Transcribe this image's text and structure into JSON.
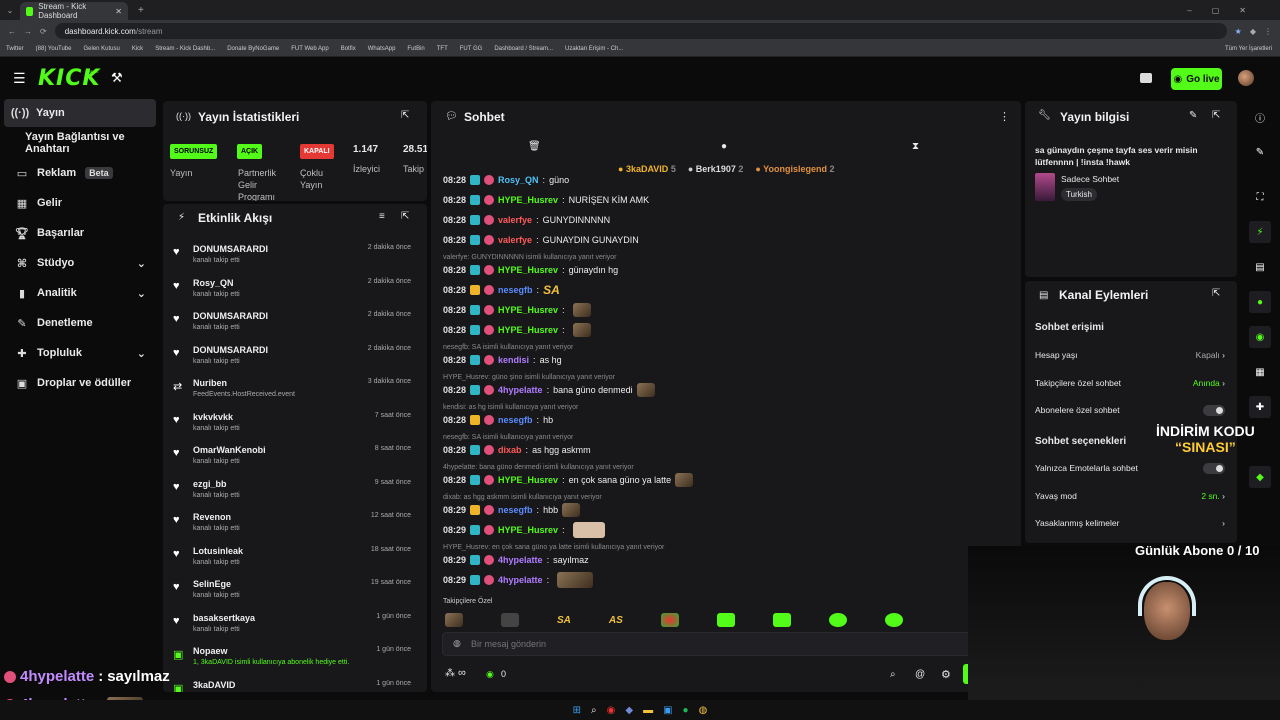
{
  "browser": {
    "tab_title": "Stream - Kick Dashboard",
    "url_host": "dashboard.kick.com",
    "url_path": "/stream",
    "bookmarks": [
      "Twitter",
      "(88) YouTube",
      "Gelen Kutusu",
      "Kick",
      "Stream - Kick Dashb...",
      "Donate ByNoGame",
      "FUT Web App",
      "Botfix",
      "WhatsApp",
      "FutBin",
      "TFT",
      "FUT GG",
      "Dashboard / Stream...",
      "Uzaktan Erişim - Ch..."
    ],
    "all_bookmarks": "Tüm Yer İşaretleri"
  },
  "header": {
    "logo": "KICK",
    "logo_sup": "BETA",
    "go_live": "Go live"
  },
  "sidebar": {
    "items": [
      {
        "label": "Yayın"
      },
      {
        "label": "Yayın Bağlantısı ve Anahtarı"
      },
      {
        "label": "Reklam",
        "badge": "Beta"
      },
      {
        "label": "Gelir"
      },
      {
        "label": "Başarılar"
      },
      {
        "label": "Stüdyo"
      },
      {
        "label": "Analitik"
      },
      {
        "label": "Denetleme"
      },
      {
        "label": "Topluluk"
      },
      {
        "label": "Droplar ve ödüller"
      }
    ]
  },
  "stats": {
    "title": "Yayın İstatistikleri",
    "tags": [
      "SORUNSUZ",
      "AÇIK",
      "KAPALI"
    ],
    "viewers": "1.147",
    "followers": "28.51",
    "labels": [
      "Yayın",
      "Partnerlik Gelir Programı",
      "Çoklu Yayın",
      "İzleyici",
      "Takip"
    ]
  },
  "feed": {
    "title": "Etkinlik Akışı",
    "items": [
      {
        "name": "DONUMSARARDI",
        "sub": "kanalı takip etti",
        "time": "2 dakika önce"
      },
      {
        "name": "Rosy_QN",
        "sub": "kanalı takip etti",
        "time": "2 dakika önce"
      },
      {
        "name": "DONUMSARARDI",
        "sub": "kanalı takip etti",
        "time": "2 dakika önce"
      },
      {
        "name": "DONUMSARARDI",
        "sub": "kanalı takip etti",
        "time": "2 dakika önce"
      },
      {
        "name": "Nuriben",
        "sub": "FeedEvents.HostReceived.event",
        "time": "3 dakika önce"
      },
      {
        "name": "kvkvkvkk",
        "sub": "kanalı takip etti",
        "time": "7 saat önce"
      },
      {
        "name": "OmarWanKenobi",
        "sub": "kanalı takip etti",
        "time": "8 saat önce"
      },
      {
        "name": "ezgi_bb",
        "sub": "kanalı takip etti",
        "time": "9 saat önce"
      },
      {
        "name": "Revenon",
        "sub": "kanalı takip etti",
        "time": "12 saat önce"
      },
      {
        "name": "Lotusinleak",
        "sub": "kanalı takip etti",
        "time": "18 saat önce"
      },
      {
        "name": "SelinEge",
        "sub": "kanalı takip etti",
        "time": "19 saat önce"
      },
      {
        "name": "basaksertkaya",
        "sub": "kanalı takip etti",
        "time": "1 gün önce"
      },
      {
        "name": "Nopaew",
        "sub": "1, 3kaDAVID isimli kullanıcıya abonelik hediye etti.",
        "time": "1 gün önce"
      },
      {
        "name": "3kaDAVID",
        "sub": "",
        "time": "1 gün önce"
      }
    ]
  },
  "chat": {
    "title": "Sohbet",
    "leaders": [
      {
        "name": "3kaDAVID",
        "count": "5"
      },
      {
        "name": "Berk1907",
        "count": "2"
      },
      {
        "name": "Yoongislegend",
        "count": "2"
      }
    ],
    "lines": [
      {
        "t": "08:28",
        "u": "Rosy_QN",
        "m": "güno",
        "c": "#4fc3f7"
      },
      {
        "t": "08:28",
        "u": "HYPE_Husrev",
        "m": "NURİŞEN KİM AMK",
        "c": "#53fc18"
      },
      {
        "t": "08:28",
        "u": "valerfye",
        "m": "GUNYDINNNNN",
        "c": "#ff5a5a"
      },
      {
        "t": "08:28",
        "u": "valerfye",
        "m": "GUNAYDIN GUNAYDIN",
        "c": "#ff5a5a"
      },
      {
        "t": "08:28",
        "u": "HYPE_Husrev",
        "m": "günaydın hg",
        "c": "#53fc18"
      },
      {
        "t": "08:28",
        "u": "nesegfb",
        "m": "SA",
        "c": "#5b8cff"
      },
      {
        "t": "08:28",
        "u": "HYPE_Husrev",
        "m": "",
        "c": "#53fc18"
      },
      {
        "t": "08:28",
        "u": "HYPE_Husrev",
        "m": "",
        "c": "#53fc18"
      },
      {
        "t": "08:28",
        "u": "kendisi",
        "m": "as hg",
        "c": "#b07cff"
      },
      {
        "t": "08:28",
        "u": "4hypelatte",
        "m": "bana güno denmedi",
        "c": "#b07cff"
      },
      {
        "t": "08:28",
        "u": "nesegfb",
        "m": "hb",
        "c": "#5b8cff"
      },
      {
        "t": "08:28",
        "u": "dixab",
        "m": "as hgg askmm",
        "c": "#ff5a5a"
      },
      {
        "t": "08:28",
        "u": "HYPE_Husrev",
        "m": "en çok sana güno ya latte",
        "c": "#53fc18"
      },
      {
        "t": "08:29",
        "u": "nesegfb",
        "m": "hbb",
        "c": "#5b8cff"
      },
      {
        "t": "08:29",
        "u": "HYPE_Husrev",
        "m": "",
        "c": "#53fc18"
      },
      {
        "t": "08:29",
        "u": "4hypelatte",
        "m": "sayılmaz",
        "c": "#b07cff"
      },
      {
        "t": "08:29",
        "u": "4hypelatte",
        "m": "",
        "c": "#b07cff"
      }
    ],
    "replies": [
      "valerfye: GUNYDINNNNN isimli kullanıcıya yanıt veriyor",
      "nesegfb: SA isimli kullanıcıya yanıt veriyor",
      "HYPE_Husrev: güno şino isimli kullanıcıya yanıt veriyor",
      "kendisi: as hg isimli kullanıcıya yanıt veriyor",
      "nesegfb: SA isimli kullanıcıya yanıt veriyor",
      "4hypelatte: bana güno denmedi isimli kullanıcıya yanıt veriyor",
      "dixab: as hgg askmm isimli kullanıcıya yanıt veriyor",
      "HYPE_Husrev: en çok sana güno ya latte isimli kullanıcıya yanıt veriyor"
    ],
    "emote_bar_label": "Takipçilere Özel",
    "emote_labels": [
      "SA",
      "AS"
    ],
    "input_placeholder": "Bir mesaj gönderin",
    "infinity": "∞",
    "points": "0"
  },
  "stream_info": {
    "title": "Yayın bilgisi",
    "text": "sa günaydın çeşme tayfa ses verir misin lütfennnn | !insta !hawk",
    "category": "Sadece Sohbet",
    "language": "Turkish"
  },
  "channel_actions": {
    "title": "Kanal Eylemleri",
    "access_heading": "Sohbet erişimi",
    "rows": [
      {
        "label": "Hesap yaşı",
        "value": "Kapalı"
      },
      {
        "label": "Takipçilere özel sohbet",
        "value": "Anında"
      },
      {
        "label": "Abonelere özel sohbet",
        "value": ""
      }
    ],
    "options_heading": "Sohbet seçenekleri",
    "rows2": [
      {
        "label": "Yalnızca Emotelarla sohbet",
        "value": ""
      },
      {
        "label": "Yavaş mod",
        "value": "2 sn."
      },
      {
        "label": "Yasaklanmış kelimeler",
        "value": ""
      }
    ]
  },
  "overlay": {
    "discount_line1": "İNDİRİM KODU",
    "discount_line2": "“SINASI”",
    "sub_goal": "Günlük Abone 0 / 10",
    "chat1_user": "4hypelatte",
    "chat1_msg": "sayılmaz",
    "chat2_user": "4hypelatte"
  },
  "colors": {
    "accent": "#53fc18",
    "panel": "#18181b",
    "bg": "#0b0b0c"
  }
}
